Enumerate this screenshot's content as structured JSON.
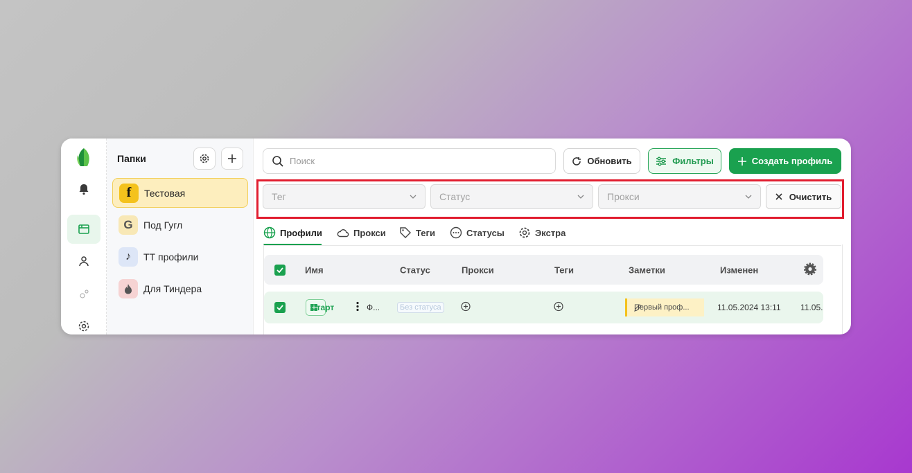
{
  "sidebar": {
    "folders_title": "Папки",
    "folders": [
      {
        "label": "Тестовая",
        "icon": "facebook-icon",
        "glyph": "f"
      },
      {
        "label": "Под Гугл",
        "icon": "google-icon",
        "glyph": "G"
      },
      {
        "label": "ТТ профили",
        "icon": "tiktok-icon",
        "glyph": "♪"
      },
      {
        "label": "Для Тиндера",
        "icon": "tinder-icon",
        "glyph": ""
      }
    ]
  },
  "toolbar": {
    "search_placeholder": "Поиск",
    "refresh_label": "Обновить",
    "filters_label": "Фильтры",
    "create_label": "Создать профиль"
  },
  "filters": {
    "tag_placeholder": "Тег",
    "status_placeholder": "Статус",
    "proxy_placeholder": "Прокси",
    "clear_label": "Очистить"
  },
  "tabs": [
    {
      "label": "Профили",
      "icon": "globe-icon"
    },
    {
      "label": "Прокси",
      "icon": "cloud-icon"
    },
    {
      "label": "Теги",
      "icon": "tag-icon"
    },
    {
      "label": "Статусы",
      "icon": "dots-circle-icon"
    },
    {
      "label": "Экстра",
      "icon": "gear-icon"
    }
  ],
  "table": {
    "columns": [
      "Имя",
      "Статус",
      "Прокси",
      "Теги",
      "Заметки",
      "Изменен"
    ],
    "rows": [
      {
        "start_label": "Старт",
        "name": "Ф...",
        "status": "Без статуса",
        "note": "Первый проф...",
        "modified": "11.05.2024 13:11",
        "extra": "11.05."
      }
    ]
  },
  "colors": {
    "accent": "#1aa14f",
    "highlight": "#e11d2f",
    "active_folder": "#fdeebe"
  }
}
